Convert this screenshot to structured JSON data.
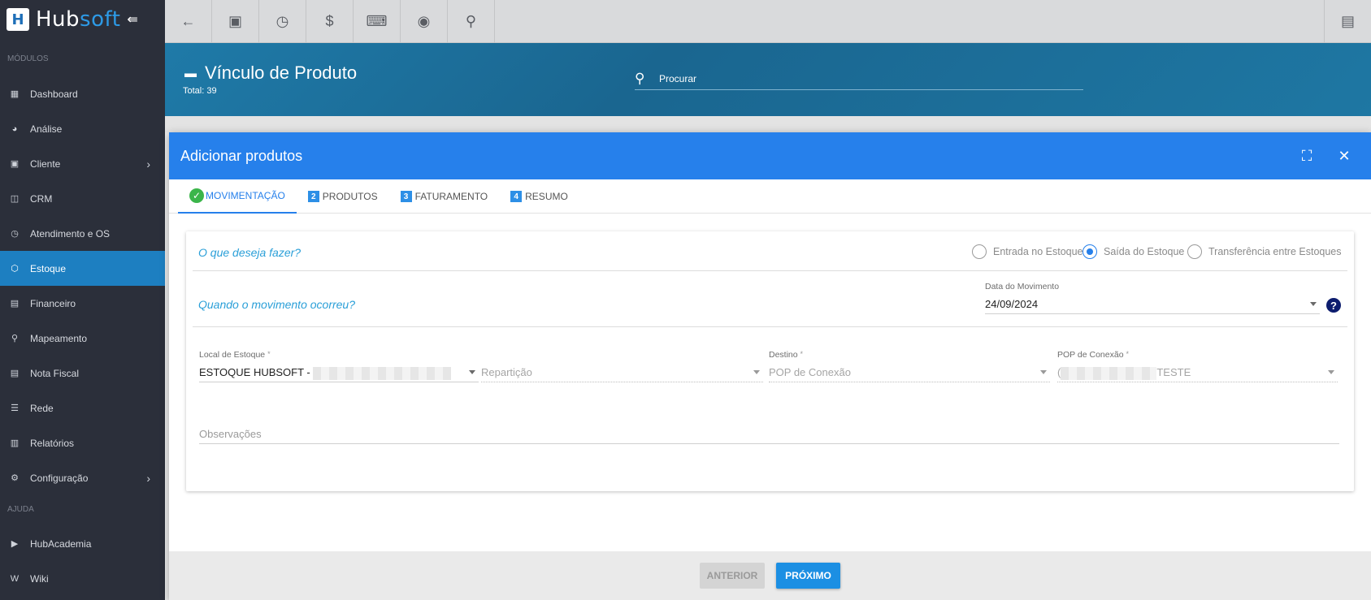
{
  "app": {
    "logo_a": "Hub",
    "logo_b": "soft"
  },
  "sidebar": {
    "section_modules": "MÓDULOS",
    "items": [
      {
        "label": "Dashboard",
        "icon": "dashboard-icon"
      },
      {
        "label": "Análise",
        "icon": "pie-chart-icon"
      },
      {
        "label": "Cliente",
        "icon": "contact-card-icon",
        "has_arrow": true
      },
      {
        "label": "CRM",
        "icon": "board-icon"
      },
      {
        "label": "Atendimento e OS",
        "icon": "calendar-clock-icon"
      },
      {
        "label": "Estoque",
        "icon": "box-icon",
        "active": true
      },
      {
        "label": "Financeiro",
        "icon": "money-icon"
      },
      {
        "label": "Mapeamento",
        "icon": "map-pin-icon"
      },
      {
        "label": "Nota Fiscal",
        "icon": "document-icon"
      },
      {
        "label": "Rede",
        "icon": "network-icon"
      },
      {
        "label": "Relatórios",
        "icon": "report-icon"
      },
      {
        "label": "Configuração",
        "icon": "gear-icon",
        "has_arrow": true
      }
    ],
    "section_help": "AJUDA",
    "help_items": [
      {
        "label": "HubAcademia",
        "icon": "video-icon"
      },
      {
        "label": "Wiki",
        "icon": "wiki-icon"
      }
    ]
  },
  "header": {
    "title": "Vínculo de Produto",
    "total": "Total: 39",
    "search_placeholder": "Procurar"
  },
  "modal": {
    "title": "Adicionar produtos",
    "tabs": [
      {
        "label": "MOVIMENTAÇÃO",
        "state": "done"
      },
      {
        "label": "PRODUTOS",
        "num": "2"
      },
      {
        "label": "FATURAMENTO",
        "num": "3"
      },
      {
        "label": "RESUMO",
        "num": "4"
      }
    ],
    "question_1": "O que deseja fazer?",
    "radio_options": [
      {
        "label": "Entrada no Estoque",
        "checked": false
      },
      {
        "label": "Saída do Estoque",
        "checked": true
      },
      {
        "label": "Transferência entre Estoques",
        "checked": false
      }
    ],
    "question_2": "Quando o movimento ocorreu?",
    "date_label": "Data do Movimento",
    "date_value": "24/09/2024",
    "local_label": "Local de Estoque",
    "local_value": "ESTOQUE HUBSOFT -",
    "reparticao_placeholder": "Repartição",
    "destino_label": "Destino",
    "destino_placeholder": "POP de Conexão",
    "pop_label": "POP de Conexão",
    "pop_value_prefix": "(",
    "pop_value_suffix": "TESTE",
    "observacoes_placeholder": "Observações",
    "required_mark": "*",
    "btn_prev": "ANTERIOR",
    "btn_next": "PRÓXIMO"
  },
  "colors": {
    "accent": "#2680eb",
    "sidebar": "#2b2f3a",
    "header": "#1e6e99",
    "active": "#1d7fc1"
  }
}
